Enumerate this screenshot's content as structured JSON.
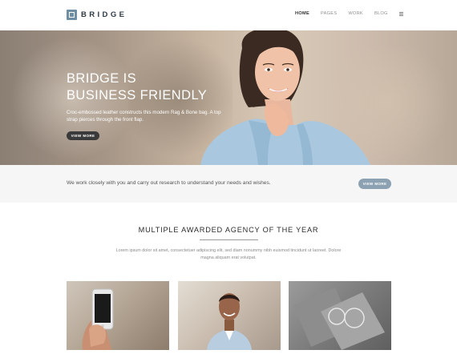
{
  "header": {
    "logo_text": "BRIDGE",
    "nav": [
      {
        "label": "HOME",
        "active": true
      },
      {
        "label": "PAGES",
        "active": false
      },
      {
        "label": "WORK",
        "active": false
      },
      {
        "label": "BLOG",
        "active": false
      }
    ]
  },
  "hero": {
    "title_line1": "BRIDGE IS",
    "title_line2": "BUSINESS FRIENDLY",
    "text": "Croc-embossed leather constructs this modern Rag & Bone bag. A top strap pierces through the front flap.",
    "button_label": "VIEW MORE"
  },
  "strip": {
    "text": "We work closely with you and carry out research to understand your needs and wishes.",
    "button_label": "VIEW MORE"
  },
  "section": {
    "title": "MULTIPLE AWARDED AGENCY OF THE YEAR",
    "text": "Lorem ipsum dolor sit amet, consectetuer adipiscing elit, sed diam nonummy nibh euismod tincidunt ut laoreet. Dolore magna aliquam erat volutpat."
  },
  "colors": {
    "accent": "#8ca2b2",
    "logo": "#6f8ea3",
    "dark_button": "#3a3a3a"
  }
}
